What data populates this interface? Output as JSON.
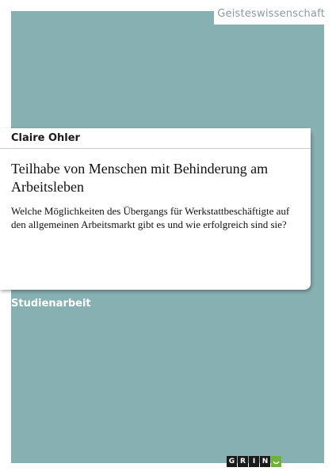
{
  "category": "Geisteswissenschaft",
  "author": "Claire Ohler",
  "title": "Teilhabe von Menschen mit Behinderung am Arbeitsleben",
  "subtitle": "Welche Möglichkeiten des Übergangs für Werkstattbeschäftigte auf den allgemeinen Arbeitsmarkt gibt es und wie erfolgreich sind sie?",
  "document_type": "Studienarbeit",
  "publisher_logo": {
    "letters": [
      "G",
      "R",
      "I",
      "N"
    ],
    "icon": "smile-icon"
  },
  "colors": {
    "cover_background": "#87b0b3",
    "logo_accent": "#6fb23a"
  }
}
